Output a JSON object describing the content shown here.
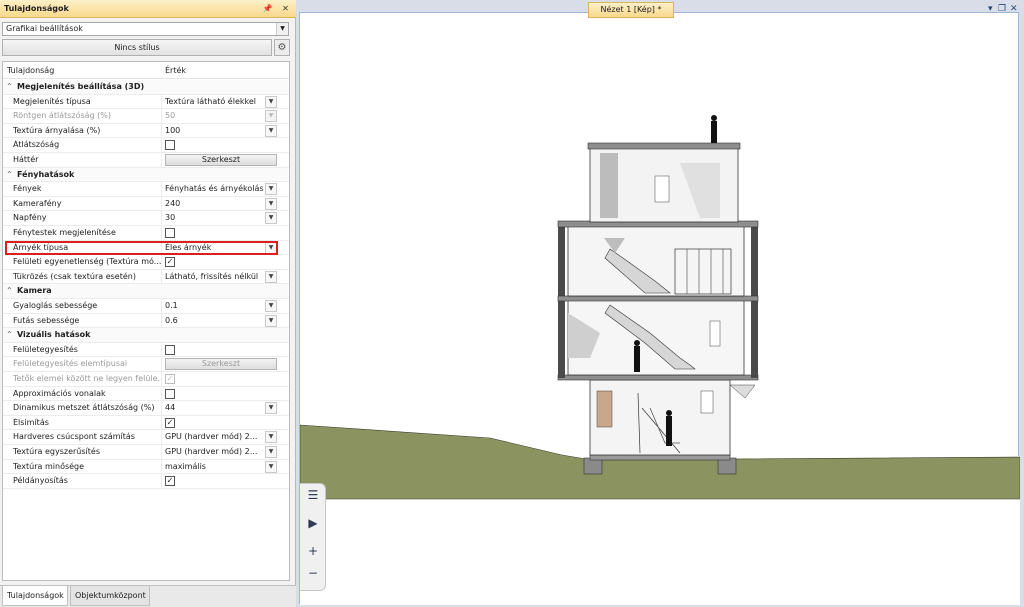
{
  "panel": {
    "title": "Tulajdonságok",
    "group_select": "Grafikai beállítások",
    "style_button": "Nincs stílus",
    "header": {
      "property": "Tulajdonság",
      "value": "Érték"
    },
    "rows": [
      {
        "kind": "group",
        "label": "Megjelenítés beállítása (3D)"
      },
      {
        "kind": "select",
        "label": "Megjelenítés típusa",
        "value": "Textúra látható élekkel"
      },
      {
        "kind": "select",
        "label": "Röntgen átlátszóság (%)",
        "value": "50",
        "disabled": true
      },
      {
        "kind": "select",
        "label": "Textúra árnyalása (%)",
        "value": "100"
      },
      {
        "kind": "check",
        "label": "Átlátszóság",
        "checked": false
      },
      {
        "kind": "button",
        "label": "Háttér",
        "value": "Szerkeszt"
      },
      {
        "kind": "group",
        "label": "Fényhatások"
      },
      {
        "kind": "select",
        "label": "Fények",
        "value": "Fényhatás és árnyékolás"
      },
      {
        "kind": "select",
        "label": "Kamerafény",
        "value": "240"
      },
      {
        "kind": "select",
        "label": "Napfény",
        "value": "30"
      },
      {
        "kind": "check",
        "label": "Fénytestek megjelenítése",
        "checked": false
      },
      {
        "kind": "select",
        "label": "Árnyék típusa",
        "value": "Éles árnyék",
        "highlight": true
      },
      {
        "kind": "check",
        "label": "Felületi egyenetlenség (Textúra mó...",
        "checked": true
      },
      {
        "kind": "select",
        "label": "Tükrözés (csak textúra esetén)",
        "value": "Látható, frissítés nélkül"
      },
      {
        "kind": "group",
        "label": "Kamera"
      },
      {
        "kind": "select",
        "label": "Gyaloglás sebessége",
        "value": "0.1"
      },
      {
        "kind": "select",
        "label": "Futás sebessége",
        "value": "0.6"
      },
      {
        "kind": "group",
        "label": "Vizuális hatások"
      },
      {
        "kind": "check",
        "label": "Felületegyesítés",
        "checked": false
      },
      {
        "kind": "button",
        "label": "Felületegyesítés elemtípusai",
        "value": "Szerkeszt",
        "disabled": true
      },
      {
        "kind": "check",
        "label": "Tetők elemei között ne legyen felüle...",
        "checked": true,
        "disabled": true
      },
      {
        "kind": "check",
        "label": "Approximációs vonalak",
        "checked": false
      },
      {
        "kind": "select",
        "label": "Dinamikus metszet átlátszóság (%)",
        "value": "44"
      },
      {
        "kind": "check",
        "label": "Élsimítás",
        "checked": true
      },
      {
        "kind": "select",
        "label": "Hardveres csúcspont számítás",
        "value": "GPU (hardver mód) 2..."
      },
      {
        "kind": "select",
        "label": "Textúra egyszerűsítés",
        "value": "GPU (hardver mód) 2..."
      },
      {
        "kind": "select",
        "label": "Textúra minősége",
        "value": "maximális"
      },
      {
        "kind": "check",
        "label": "Példányosítás",
        "checked": true
      }
    ],
    "tabs": [
      "Tulajdonságok",
      "Objektumközpont"
    ]
  },
  "view": {
    "tab_title": "Nézet 1 [Kép] *"
  },
  "colors": {
    "highlight": "#d82020",
    "terrain": "#8b9460",
    "title_bar": "#f8d98c"
  },
  "icons": [
    "pin-icon",
    "close-icon",
    "gear-icon",
    "list-icon",
    "play-icon",
    "zoom-in-icon",
    "zoom-out-icon"
  ]
}
